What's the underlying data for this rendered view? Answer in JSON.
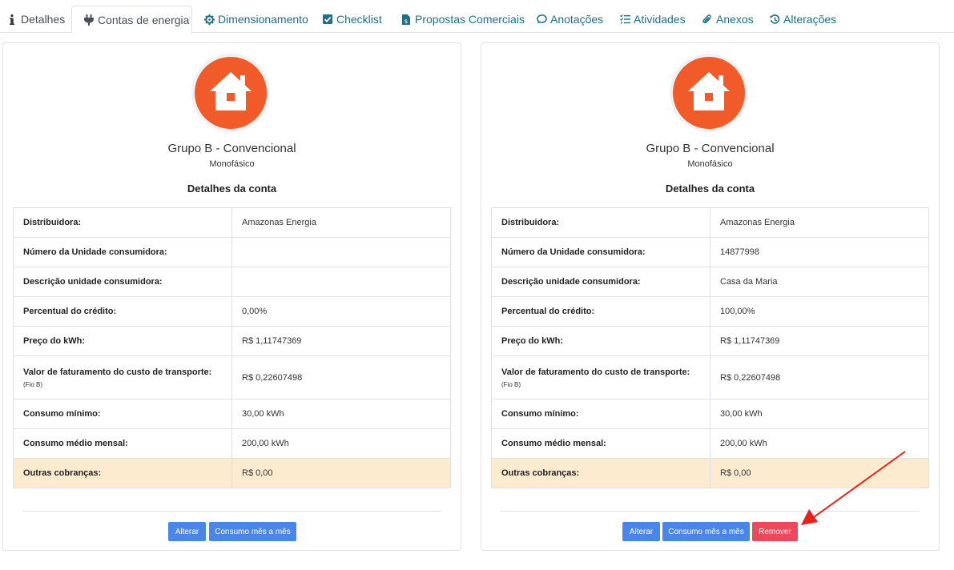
{
  "tabs": [
    {
      "label": "Detalhes",
      "icon": "info-icon"
    },
    {
      "label": "Contas de energia",
      "icon": "plug-icon"
    },
    {
      "label": "Dimensionamento",
      "icon": "cog-icon"
    },
    {
      "label": "Checklist",
      "icon": "check-square-icon"
    },
    {
      "label": "Propostas Comerciais",
      "icon": "file-dollar-icon"
    },
    {
      "label": "Anotações",
      "icon": "comment-icon"
    },
    {
      "label": "Atividades",
      "icon": "task-list-icon"
    },
    {
      "label": "Anexos",
      "icon": "paperclip-icon"
    },
    {
      "label": "Alterações",
      "icon": "history-icon"
    }
  ],
  "accent_color": "#f15a29",
  "cards": [
    {
      "group": "Grupo B - Convencional",
      "phase": "Monofásico",
      "section_title": "Detalhes da conta",
      "rows": [
        {
          "label": "Distribuidora:",
          "value": "Amazonas Energia"
        },
        {
          "label": "Número da Unidade consumidora:",
          "value": ""
        },
        {
          "label": "Descrição unidade consumidora:",
          "value": ""
        },
        {
          "label": "Percentual do crédito:",
          "value": "0,00%"
        },
        {
          "label": "Preço do kWh:",
          "value": "R$ 1,11747369"
        },
        {
          "label": "Valor de faturamento do custo de transporte:",
          "sub": "(Fio B)",
          "value": "R$ 0,22607498"
        },
        {
          "label": "Consumo mínimo:",
          "value": "30,00 kWh"
        },
        {
          "label": "Consumo médio mensal:",
          "value": "200,00 kWh"
        },
        {
          "label": "Outras cobranças:",
          "value": "R$ 0,00"
        }
      ],
      "buttons": {
        "edit": "Alterar",
        "monthly": "Consumo mês a mês"
      }
    },
    {
      "group": "Grupo B - Convencional",
      "phase": "Monofásico",
      "section_title": "Detalhes da conta",
      "rows": [
        {
          "label": "Distribuidora:",
          "value": "Amazonas Energia"
        },
        {
          "label": "Número da Unidade consumidora:",
          "value": "14877998"
        },
        {
          "label": "Descrição unidade consumidora:",
          "value": "Casa da Maria"
        },
        {
          "label": "Percentual do crédito:",
          "value": "100,00%"
        },
        {
          "label": "Preço do kWh:",
          "value": "R$ 1,11747369"
        },
        {
          "label": "Valor de faturamento do custo de transporte:",
          "sub": "(Fio B)",
          "value": "R$ 0,22607498"
        },
        {
          "label": "Consumo mínimo:",
          "value": "30,00 kWh"
        },
        {
          "label": "Consumo médio mensal:",
          "value": "200,00 kWh"
        },
        {
          "label": "Outras cobranças:",
          "value": "R$ 0,00"
        }
      ],
      "buttons": {
        "edit": "Alterar",
        "monthly": "Consumo mês a mês",
        "remove": "Remover"
      }
    }
  ]
}
